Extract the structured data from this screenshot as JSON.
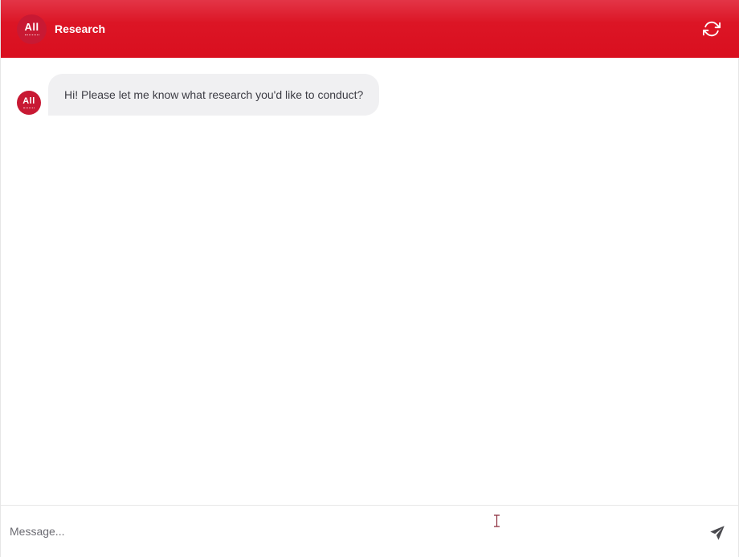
{
  "header": {
    "logo_text": "All",
    "title": "Research",
    "refresh_icon": "refresh-icon",
    "background_color": "#dc1525"
  },
  "chat": {
    "messages": [
      {
        "sender": "bot",
        "avatar_text": "All",
        "text": "Hi! Please let me know what research you'd like to conduct?"
      }
    ],
    "bubble_color": "#f0f0f2"
  },
  "composer": {
    "placeholder": "Message...",
    "value": "",
    "send_icon": "send-icon"
  },
  "colors": {
    "brand": "#c81933",
    "accent": "#dc1525"
  }
}
